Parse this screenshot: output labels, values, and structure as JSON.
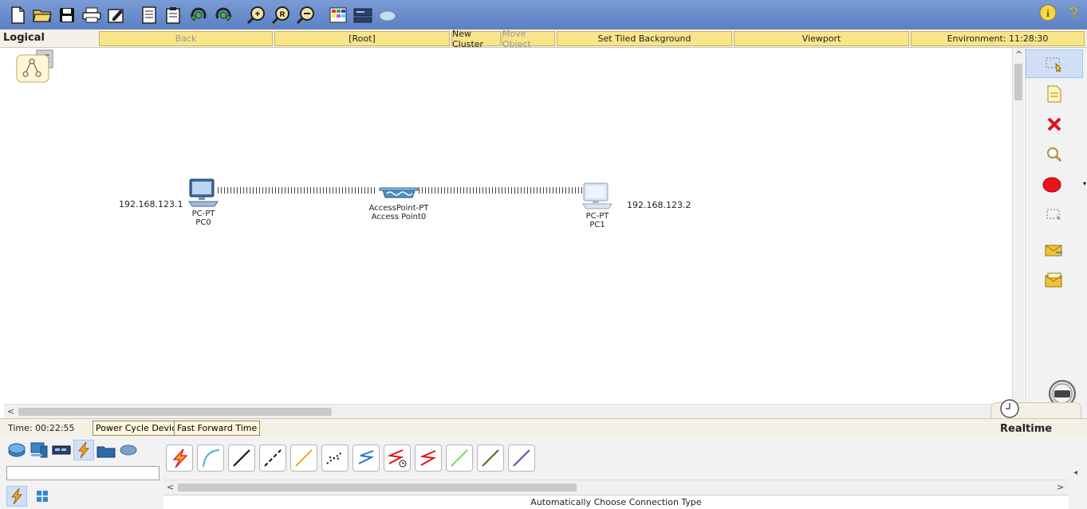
{
  "navbar": {
    "mode": "Logical",
    "back": "Back",
    "root": "[Root]",
    "new_cluster": "New Cluster",
    "move_object": "Move Object",
    "set_tiled_background": "Set Tiled Background",
    "viewport": "Viewport",
    "environment": "Environment: 11:28:30"
  },
  "toolbar": {
    "icons": [
      "new-file-icon",
      "open-folder-icon",
      "save-icon",
      "print-icon",
      "activity-wizard-icon",
      "copy-icon",
      "paste-icon",
      "undo-icon",
      "redo-icon",
      "zoom-in-icon",
      "zoom-reset-icon",
      "zoom-out-icon",
      "palette-icon",
      "custom-device-icon",
      "cloud-icon",
      "info-icon",
      "help-icon"
    ]
  },
  "devices": {
    "pc0": {
      "type": "PC-PT",
      "name": "PC0",
      "ip": "192.168.123.1"
    },
    "ap0": {
      "type": "AccessPoint-PT",
      "name": "Access Point0"
    },
    "pc1": {
      "type": "PC-PT",
      "name": "PC1",
      "ip": "192.168.123.2"
    }
  },
  "status": {
    "time": "Time: 00:22:55",
    "power_cycle": "Power Cycle Devices",
    "fast_forward": "Fast Forward Time",
    "mode": "Realtime"
  },
  "bottom": {
    "description": "Automatically Choose Connection Type",
    "cables": [
      "auto-connection-icon",
      "console-cable-icon",
      "straight-through-cable-icon",
      "crossover-cable-icon",
      "fiber-cable-icon",
      "phone-cable-icon",
      "coaxial-cable-icon",
      "serial-dce-icon",
      "serial-dte-icon",
      "octal-cable-icon",
      "iot-custom-cable-icon",
      "usb-cable-icon"
    ]
  },
  "colors": {
    "toolbar": "#6a8fcf",
    "nav_cell": "#f8e58a",
    "delete": "#d9151c",
    "ellipse": "#e8141c"
  }
}
